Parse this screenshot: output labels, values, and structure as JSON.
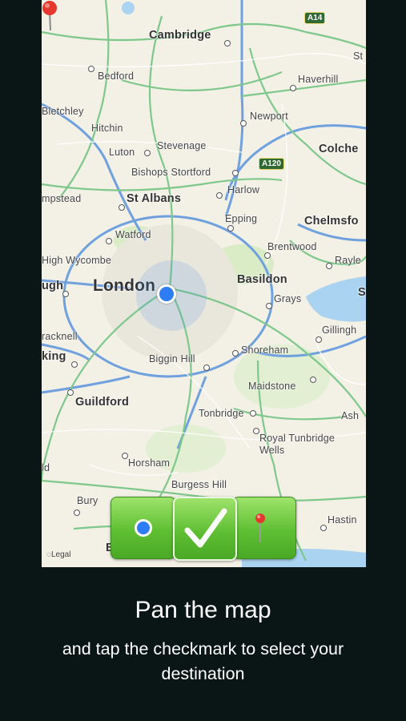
{
  "map": {
    "legal": "Legal",
    "road_shields": [
      {
        "id": "a14",
        "text": "A14"
      },
      {
        "id": "a120",
        "text": "A120"
      }
    ],
    "places": {
      "cambridge": "Cambridge",
      "bedford": "Bedford",
      "haverhill": "Haverhill",
      "bletchley": "Bletchley",
      "hitchin": "Hitchin",
      "newport": "Newport",
      "stevenage": "Stevenage",
      "luton": "Luton",
      "colchester": "Colche",
      "bishops_stortford": "Bishops Stortford",
      "hempstead": "mpstead",
      "st_albans": "St Albans",
      "harlow": "Harlow",
      "chelmsford": "Chelmsfo",
      "epping": "Epping",
      "watford": "Watford",
      "brentwood": "Brentwood",
      "rayleigh": "Rayle",
      "high_wycombe": "High Wycombe",
      "basildon": "Basildon",
      "slough": "ugh",
      "london": "London",
      "grays": "Grays",
      "s_edge": "S",
      "bracknell": "racknell",
      "gillingham": "Gillingh",
      "woking": "king",
      "shoreham": "Shoreham",
      "biggin_hill": "Biggin Hill",
      "maidstone": "Maidstone",
      "guildford": "Guildford",
      "tonbridge": "Tonbridge",
      "ash": "Ash",
      "royal_tunbridge_1": "Royal Tunbridge",
      "royal_tunbridge_2": "Wells",
      "horsham": "Horsham",
      "ld": "ld",
      "burgess_hill": "Burgess Hill",
      "bury": "Bury",
      "hastings": "Hastin",
      "b_edge": "B",
      "st_edge": "St"
    }
  },
  "toolbar": {
    "current_location_icon": "current-location-dot-icon",
    "confirm_icon": "checkmark-icon",
    "destination_icon": "destination-pin-icon"
  },
  "caption": {
    "title": "Pan the map",
    "subtitle": "and tap the checkmark to select your destination"
  },
  "colors": {
    "background": "#0a1616",
    "button_green": "#6cc83c",
    "user_dot": "#2e7cf6",
    "pin_red": "#e5372e"
  }
}
